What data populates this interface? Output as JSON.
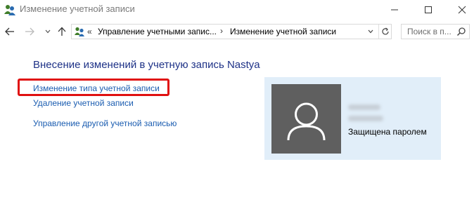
{
  "window": {
    "title": "Изменение учетной записи",
    "minimize_icon": "minimize-icon",
    "maximize_icon": "maximize-icon",
    "close_icon": "close-icon"
  },
  "nav": {
    "back_icon": "arrow-left-icon",
    "forward_icon": "arrow-right-icon",
    "recent_icon": "chevron-down-icon",
    "up_icon": "arrow-up-icon"
  },
  "address": {
    "overflow": "«",
    "breadcrumbs": [
      "Управление учетными запис...",
      "Изменение учетной записи"
    ],
    "separator": "›"
  },
  "search": {
    "placeholder": "Поиск в п..."
  },
  "main": {
    "title": "Внесение изменений в учетную запись Nastya",
    "links": [
      "Изменение типа учетной записи",
      "Удаление учетной записи",
      "Управление другой учетной записью"
    ],
    "highlight_color": "#e01010",
    "link_color": "#1a5cb0",
    "title_color": "#1e3287"
  },
  "account": {
    "status": "Защищена паролем",
    "panel_color": "#e1eef9",
    "avatar_color": "#5f5f5f"
  }
}
